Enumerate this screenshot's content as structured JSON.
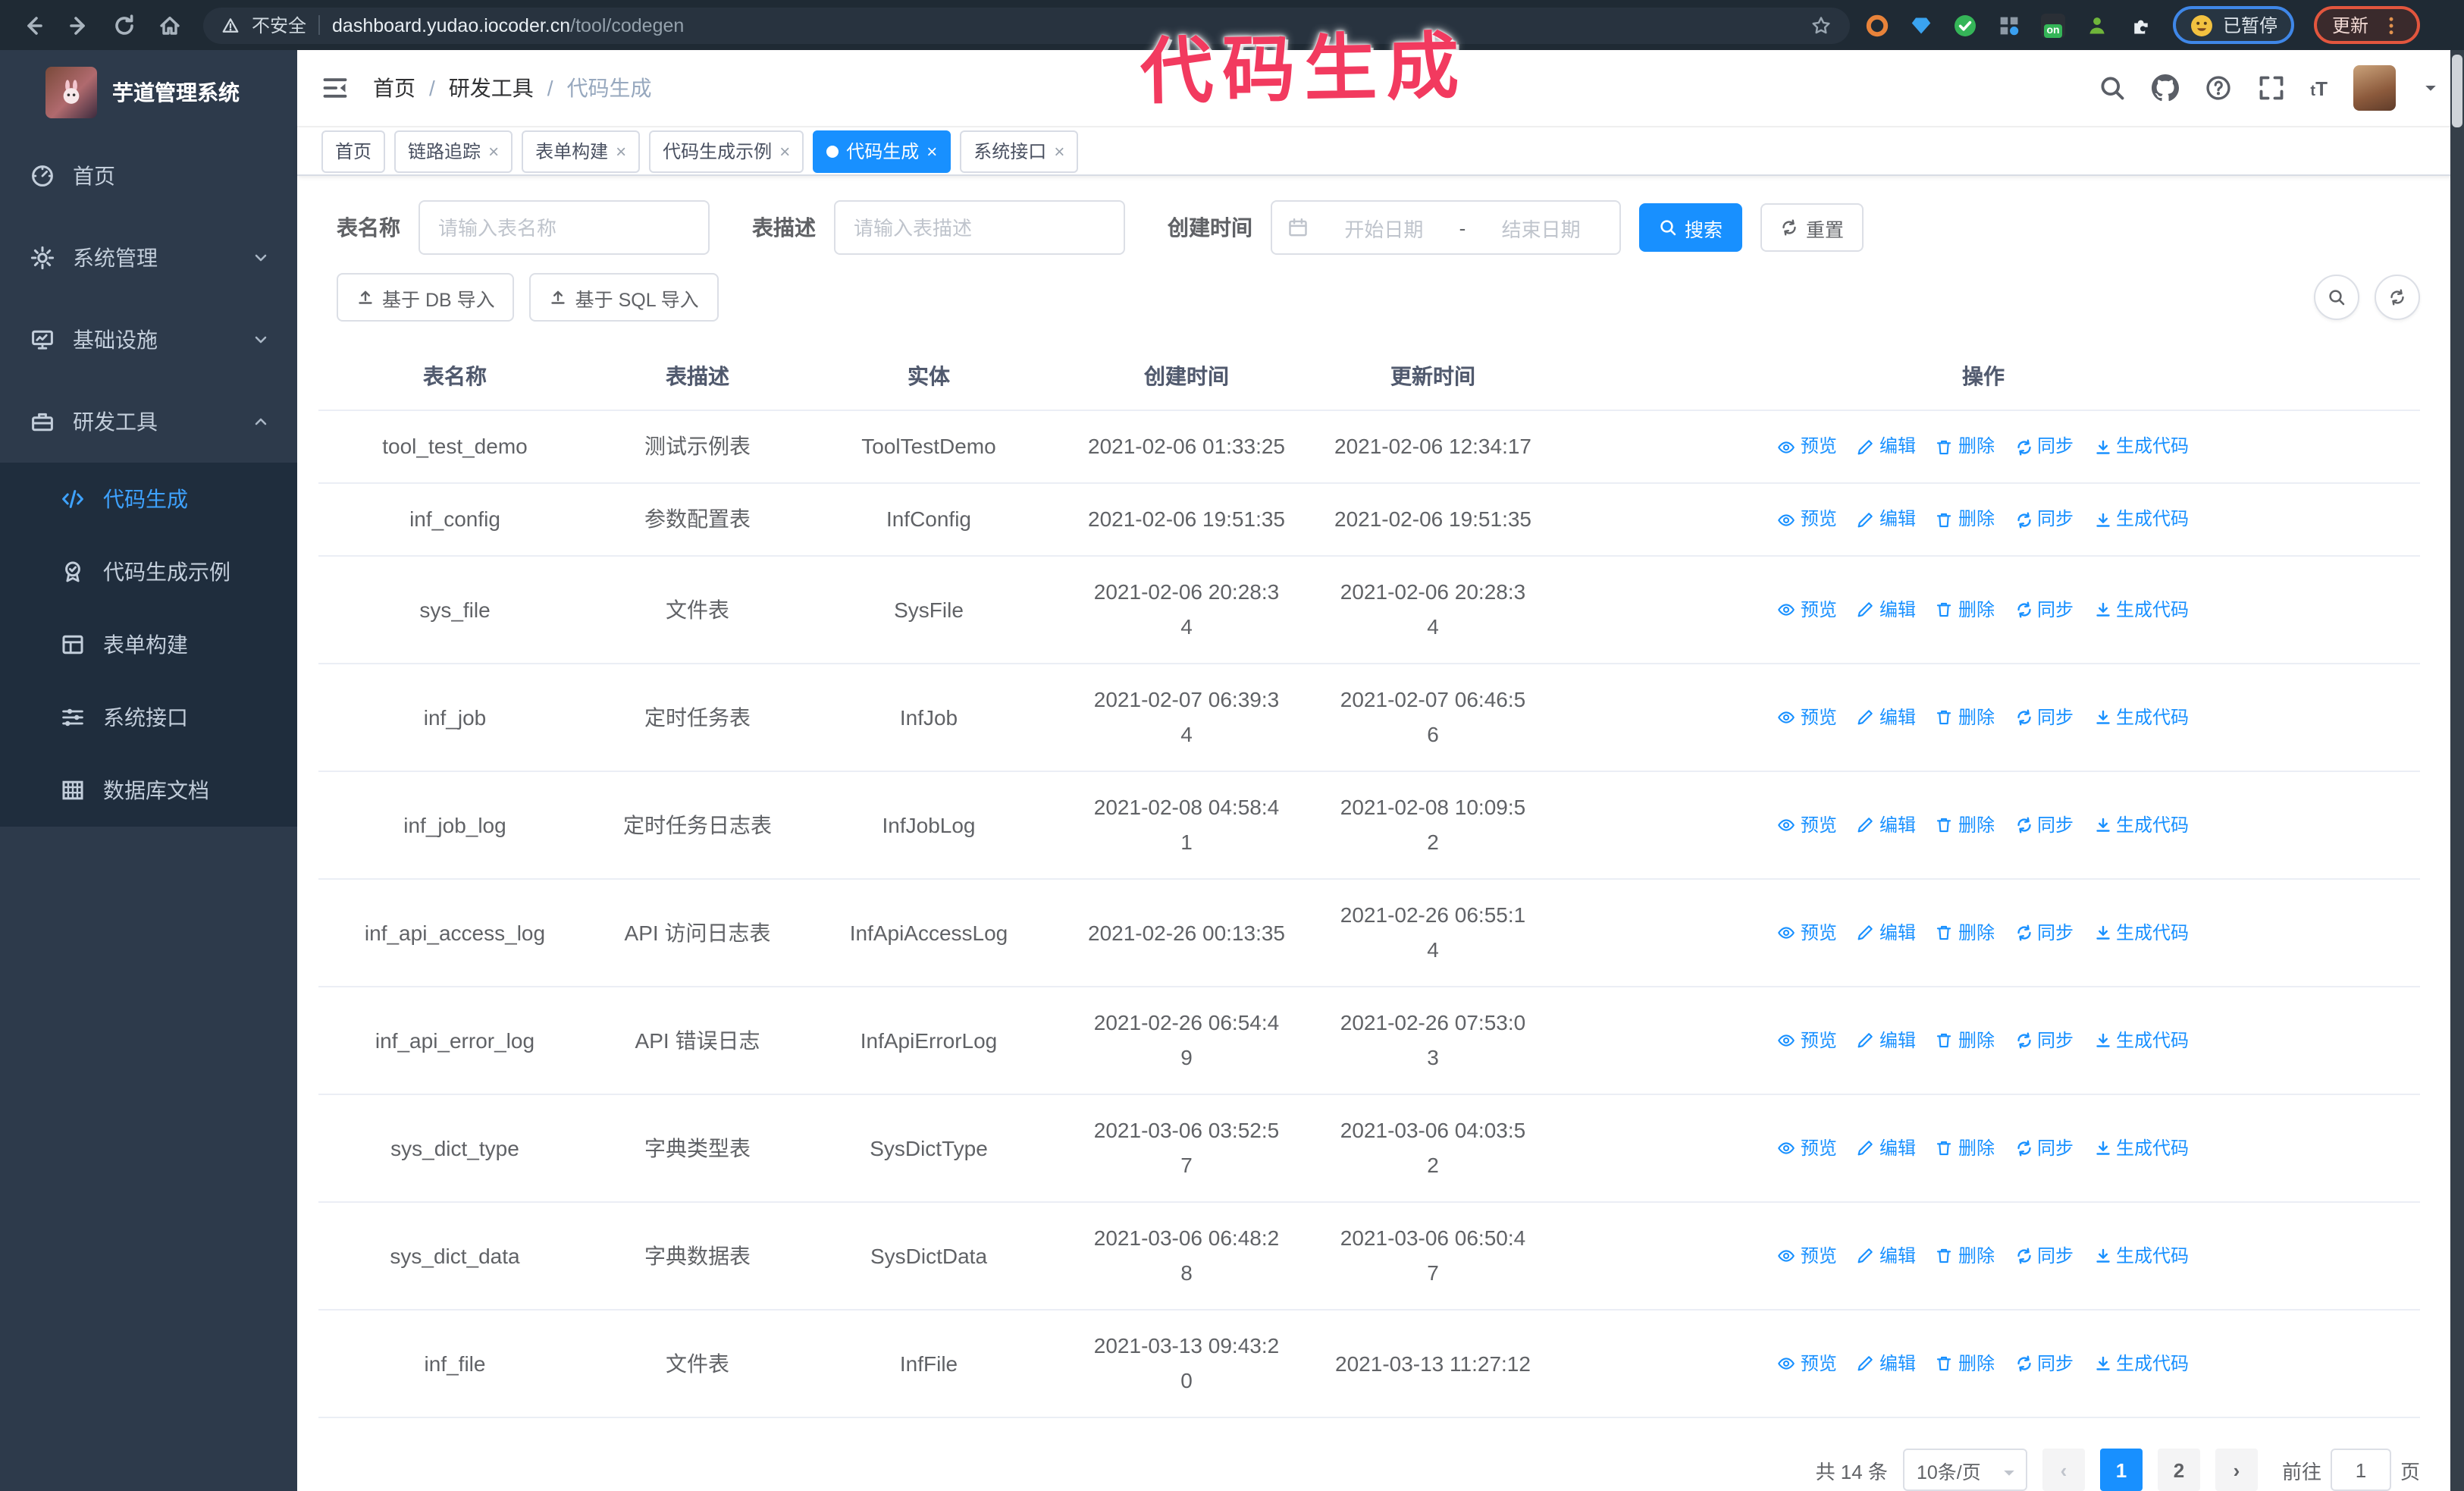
{
  "colors": {
    "accent": "#1890ff",
    "sidebar_bg": "#2d3a4b",
    "submenu_bg": "#1f2d3d",
    "sidebar_active": "#3ea2ff",
    "annotation": "#f23a5f",
    "browser_bar": "#1f2a34"
  },
  "browser": {
    "insecure_label": "不安全",
    "url_host": "dashboard.yudao.iocoder.cn",
    "url_path": "/tool/codegen",
    "paused_badge": "已暂停",
    "update_button": "更新"
  },
  "annotation": {
    "text": "代码生成"
  },
  "sidebar": {
    "logo_title": "芋道管理系统",
    "menu": [
      {
        "label": "首页"
      },
      {
        "label": "系统管理"
      },
      {
        "label": "基础设施"
      },
      {
        "label": "研发工具"
      }
    ],
    "submenu": [
      {
        "label": "代码生成"
      },
      {
        "label": "代码生成示例"
      },
      {
        "label": "表单构建"
      },
      {
        "label": "系统接口"
      },
      {
        "label": "数据库文档"
      }
    ]
  },
  "header": {
    "breadcrumb": [
      "首页",
      "研发工具",
      "代码生成"
    ]
  },
  "tabs": [
    {
      "label": "首页"
    },
    {
      "label": "链路追踪"
    },
    {
      "label": "表单构建"
    },
    {
      "label": "代码生成示例"
    },
    {
      "label": "代码生成"
    },
    {
      "label": "系统接口"
    }
  ],
  "filters": {
    "name_label": "表名称",
    "name_placeholder": "请输入表名称",
    "desc_label": "表描述",
    "desc_placeholder": "请输入表描述",
    "time_label": "创建时间",
    "start_placeholder": "开始日期",
    "range_separator": "-",
    "end_placeholder": "结束日期",
    "search_label": "搜索",
    "reset_label": "重置"
  },
  "toolbar": {
    "import_db_label": "基于 DB 导入",
    "import_sql_label": "基于 SQL 导入"
  },
  "table": {
    "headers": [
      "表名称",
      "表描述",
      "实体",
      "创建时间",
      "更新时间",
      "操作"
    ],
    "actions": [
      "预览",
      "编辑",
      "删除",
      "同步",
      "生成代码"
    ],
    "rows": [
      {
        "name": "tool_test_demo",
        "desc": "测试示例表",
        "entity": "ToolTestDemo",
        "created": "2021-02-06 01:33:25",
        "updated": "2021-02-06 12:34:17"
      },
      {
        "name": "inf_config",
        "desc": "参数配置表",
        "entity": "InfConfig",
        "created": "2021-02-06 19:51:35",
        "updated": "2021-02-06 19:51:35"
      },
      {
        "name": "sys_file",
        "desc": "文件表",
        "entity": "SysFile",
        "created": "2021-02-06 20:28:3\n4",
        "updated": "2021-02-06 20:28:3\n4"
      },
      {
        "name": "inf_job",
        "desc": "定时任务表",
        "entity": "InfJob",
        "created": "2021-02-07 06:39:3\n4",
        "updated": "2021-02-07 06:46:5\n6"
      },
      {
        "name": "inf_job_log",
        "desc": "定时任务日志表",
        "entity": "InfJobLog",
        "created": "2021-02-08 04:58:4\n1",
        "updated": "2021-02-08 10:09:5\n2"
      },
      {
        "name": "inf_api_access_log",
        "desc": "API 访问日志表",
        "entity": "InfApiAccessLog",
        "created": "2021-02-26 00:13:35",
        "updated": "2021-02-26 06:55:1\n4"
      },
      {
        "name": "inf_api_error_log",
        "desc": "API 错误日志",
        "entity": "InfApiErrorLog",
        "created": "2021-02-26 06:54:4\n9",
        "updated": "2021-02-26 07:53:0\n3"
      },
      {
        "name": "sys_dict_type",
        "desc": "字典类型表",
        "entity": "SysDictType",
        "created": "2021-03-06 03:52:5\n7",
        "updated": "2021-03-06 04:03:5\n2"
      },
      {
        "name": "sys_dict_data",
        "desc": "字典数据表",
        "entity": "SysDictData",
        "created": "2021-03-06 06:48:2\n8",
        "updated": "2021-03-06 06:50:4\n7"
      },
      {
        "name": "inf_file",
        "desc": "文件表",
        "entity": "InfFile",
        "created": "2021-03-13 09:43:2\n0",
        "updated": "2021-03-13 11:27:12"
      }
    ]
  },
  "pagination": {
    "total_label": "共 14 条",
    "page_size_label": "10条/页",
    "pages": [
      "1",
      "2"
    ],
    "goto_label": "前往",
    "goto_value": "1",
    "unit_label": "页"
  }
}
